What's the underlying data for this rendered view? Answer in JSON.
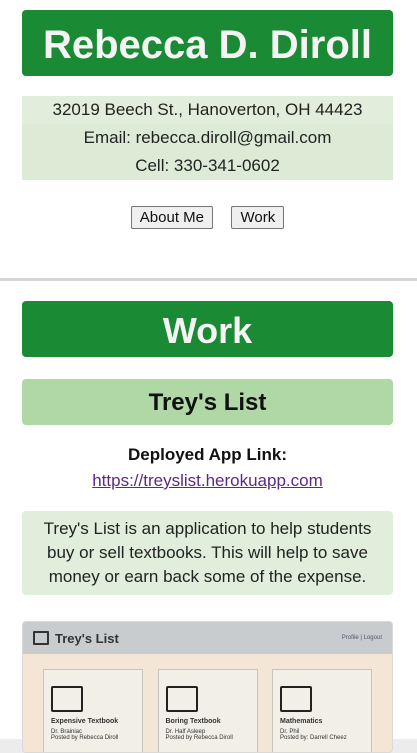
{
  "profile": {
    "name": "Rebecca D. Diroll",
    "address": "32019 Beech St., Hanoverton, OH 44423",
    "email": "Email: rebecca.diroll@gmail.com",
    "cell": "Cell: 330-341-0602"
  },
  "nav": {
    "about_label": "About Me",
    "work_label": "Work"
  },
  "work": {
    "title": "Work",
    "project": {
      "name": "Trey's List",
      "deploy_label": "Deployed App Link:",
      "deploy_url": "https://treyslist.herokuapp.com",
      "description": "Trey's List is an application to help students buy or sell textbooks. This will help to save money or earn back some of the expense."
    }
  },
  "screenshot": {
    "app_title": "Trey's List",
    "header_links": "Profile | Logout",
    "books": [
      {
        "title": "Expensive Textbook",
        "author": "Dr. Brainiac",
        "posted": "Posted by Rebecca Diroll",
        "icon": "book-icon"
      },
      {
        "title": "Boring Textbook",
        "author": "Dr. Half Asleep",
        "posted": "Posted by Rebecca Diroll",
        "icon": "book-icon"
      },
      {
        "title": "Mathematics",
        "author": "Dr. Phil",
        "posted": "Posted by: Darrell Cheez",
        "icon": "book-icon"
      }
    ]
  },
  "colors": {
    "banner_green": "#1b8a34",
    "sub_green": "#afd8a6",
    "light_green": "#e1eedb",
    "link_purple": "#5b2a86"
  }
}
